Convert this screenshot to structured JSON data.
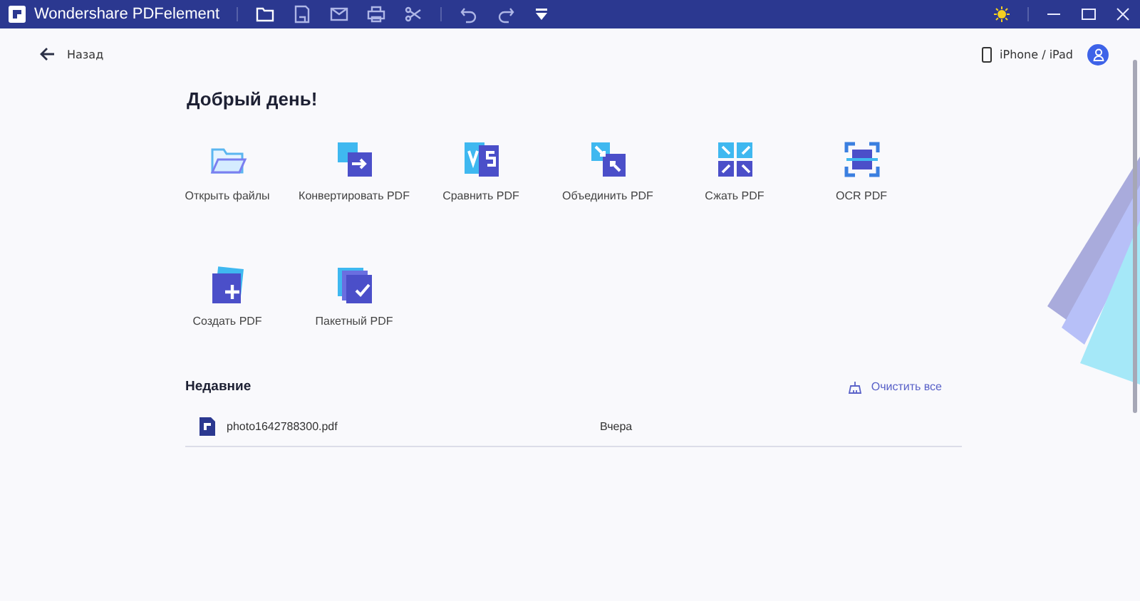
{
  "window": {
    "title": "Wondershare PDFelement"
  },
  "nav": {
    "back": "Назад",
    "device": "iPhone / iPad"
  },
  "greeting": "Добрый день!",
  "tools": [
    {
      "kind": "open",
      "label": "Открыть файлы"
    },
    {
      "kind": "convert",
      "label": "Конвертировать PDF"
    },
    {
      "kind": "compare",
      "label": "Сравнить PDF"
    },
    {
      "kind": "combine",
      "label": "Объединить PDF"
    },
    {
      "kind": "compress",
      "label": "Сжать PDF"
    },
    {
      "kind": "ocr",
      "label": "OCR PDF"
    },
    {
      "kind": "create",
      "label": "Создать PDF"
    },
    {
      "kind": "batch",
      "label": "Пакетный PDF"
    }
  ],
  "recent": {
    "title": "Недавние",
    "clear": "Очистить все",
    "files": [
      {
        "name": "photo1642788300.pdf",
        "date": "Вчера"
      }
    ]
  }
}
